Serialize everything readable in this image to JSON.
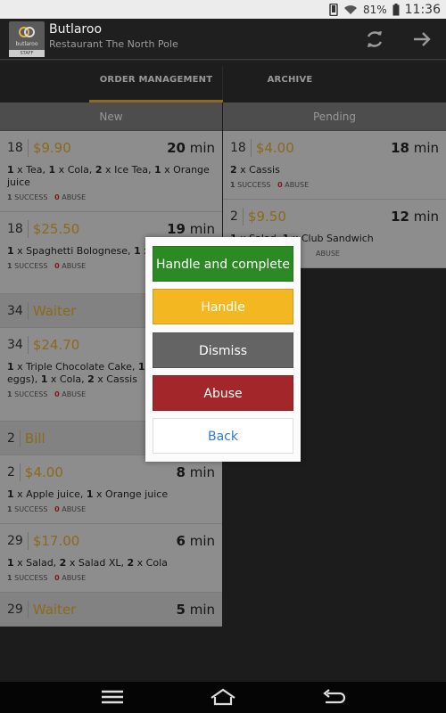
{
  "status": {
    "battery": "81%",
    "time": "11:36"
  },
  "app": {
    "title": "Butlaroo",
    "subtitle": "Restaurant The North Pole",
    "logo_text": "butlaroo",
    "logo_badge": "STAFF"
  },
  "tabs": [
    {
      "label": "ORDER MANAGEMENT",
      "active": true
    },
    {
      "label": "ARCHIVE",
      "active": false
    }
  ],
  "columns": {
    "new": {
      "header": "New",
      "cards": [
        {
          "table": "18",
          "amount": "$9.90",
          "time": "20 min",
          "items": "1 x Tea, 1 x Cola, 2 x Ice Tea, 1 x Orange juice",
          "success": "1",
          "success_label": "SUCCESS",
          "abuse": "0",
          "abuse_label": "ABUSE"
        },
        {
          "table": "18",
          "amount": "$25.50",
          "time": "19 min",
          "items": "1 x Spaghetti Bolognese, 1 x V Schnitzel",
          "success": "1",
          "success_label": "SUCCESS",
          "abuse": "0",
          "abuse_label": "ABUSE"
        },
        {
          "table": "34",
          "label": "Waiter"
        },
        {
          "table": "34",
          "amount": "$24.70",
          "items": "1 x Triple Chocolate Cake, 1 x Large (10 eggs), 1 x Cola, 2 x Cassis",
          "success": "1",
          "success_label": "SUCCESS",
          "abuse": "0",
          "abuse_label": "ABUSE"
        },
        {
          "table": "2",
          "label": "Bill"
        },
        {
          "table": "2",
          "amount": "$4.00",
          "time": "8 min",
          "items": "1 x Apple juice, 1 x Orange juice",
          "success": "1",
          "success_label": "SUCCESS",
          "abuse": "0",
          "abuse_label": "ABUSE"
        },
        {
          "table": "29",
          "amount": "$17.00",
          "time": "6 min",
          "items": "1 x Salad, 2 x Salad XL, 2 x Cola",
          "success": "1",
          "success_label": "SUCCESS",
          "abuse": "0",
          "abuse_label": "ABUSE"
        },
        {
          "table": "29",
          "label": "Waiter",
          "time": "5 min"
        }
      ]
    },
    "pending": {
      "header": "Pending",
      "cards": [
        {
          "table": "18",
          "amount": "$4.00",
          "time": "18 min",
          "items": "2 x Cassis",
          "success": "1",
          "success_label": "SUCCESS",
          "abuse": "0",
          "abuse_label": "ABUSE"
        },
        {
          "table": "2",
          "amount": "$9.50",
          "time": "12 min",
          "items": "1 x Salad, 1 x Club Sandwich",
          "abuse_label": "ABUSE"
        }
      ]
    }
  },
  "dialog": {
    "handle_complete": "Handle and complete",
    "handle": "Handle",
    "dismiss": "Dismiss",
    "abuse": "Abuse",
    "back": "Back"
  },
  "colors": {
    "accent": "#d9a233",
    "amount": "#d7a12a",
    "green": "#2b8a24",
    "yellow": "#f3b721",
    "grey": "#646464",
    "red": "#a3262b",
    "link": "#2e7ad8"
  }
}
